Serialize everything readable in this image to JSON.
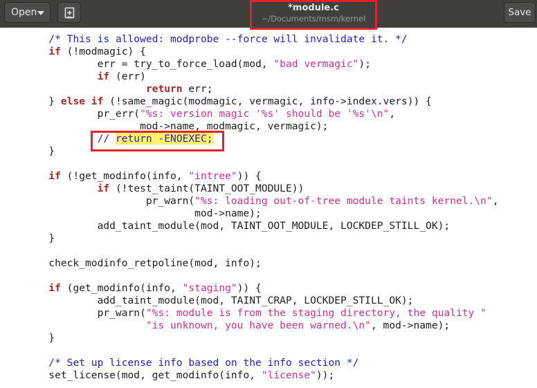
{
  "toolbar": {
    "open_label": "Open",
    "open_icon": "chevron-down-icon",
    "new_icon": "new-document-icon",
    "save_label": "Save"
  },
  "window": {
    "title": "*module.c",
    "path": "~/Documents/msm/kernel"
  },
  "code_lines": [
    [
      {
        "t": "        "
      },
      {
        "t": "/* This is allowed: modprobe --force will invalidate it. */",
        "c": "cmt"
      }
    ],
    [
      {
        "t": "        "
      },
      {
        "t": "if",
        "c": "kw"
      },
      {
        "t": " (!modmagic) {"
      }
    ],
    [
      {
        "t": "                err = try_to_force_load(mod, "
      },
      {
        "t": "\"bad vermagic\"",
        "c": "str"
      },
      {
        "t": ");"
      }
    ],
    [
      {
        "t": "                "
      },
      {
        "t": "if",
        "c": "kw"
      },
      {
        "t": " (err)"
      }
    ],
    [
      {
        "t": "                        "
      },
      {
        "t": "return",
        "c": "kw"
      },
      {
        "t": " err;"
      }
    ],
    [
      {
        "t": "        } "
      },
      {
        "t": "else if",
        "c": "kw"
      },
      {
        "t": " (!same_magic(modmagic, vermagic, info->index.vers)) {"
      }
    ],
    [
      {
        "t": "                pr_err("
      },
      {
        "t": "\"%s: version magic '%s' should be '%s'\\n\"",
        "c": "str"
      },
      {
        "t": ","
      }
    ],
    [
      {
        "t": "                       mod->name, modmagic, vermagic);"
      }
    ],
    [
      {
        "t": "                "
      },
      {
        "t": "// ",
        "c": "cmt"
      },
      {
        "t": "return -ENOEXEC;",
        "c": "cmt hl"
      }
    ],
    [
      {
        "t": "        }"
      }
    ],
    [],
    [
      {
        "t": "        "
      },
      {
        "t": "if",
        "c": "kw"
      },
      {
        "t": " (!get_modinfo(info, "
      },
      {
        "t": "\"intree\"",
        "c": "str"
      },
      {
        "t": ")) {"
      }
    ],
    [
      {
        "t": "                "
      },
      {
        "t": "if",
        "c": "kw"
      },
      {
        "t": " (!test_taint(TAINT_OOT_MODULE))"
      }
    ],
    [
      {
        "t": "                        pr_warn("
      },
      {
        "t": "\"%s: loading out-of-tree module taints kernel.\\n\"",
        "c": "str"
      },
      {
        "t": ","
      }
    ],
    [
      {
        "t": "                                mod->name);"
      }
    ],
    [
      {
        "t": "                add_taint_module(mod, TAINT_OOT_MODULE, LOCKDEP_STILL_OK);"
      }
    ],
    [
      {
        "t": "        }"
      }
    ],
    [],
    [
      {
        "t": "        check_modinfo_retpoline(mod, info);"
      }
    ],
    [],
    [
      {
        "t": "        "
      },
      {
        "t": "if",
        "c": "kw"
      },
      {
        "t": " (get_modinfo(info, "
      },
      {
        "t": "\"staging\"",
        "c": "str"
      },
      {
        "t": ")) {"
      }
    ],
    [
      {
        "t": "                add_taint_module(mod, TAINT_CRAP, LOCKDEP_STILL_OK);"
      }
    ],
    [
      {
        "t": "                pr_warn("
      },
      {
        "t": "\"%s: module is from the staging directory, the quality \"",
        "c": "str"
      }
    ],
    [
      {
        "t": "                        "
      },
      {
        "t": "\"is unknown, you have been warned.\\n\"",
        "c": "str"
      },
      {
        "t": ", mod->name);"
      }
    ],
    [
      {
        "t": "        }"
      }
    ],
    [],
    [
      {
        "t": "        "
      },
      {
        "t": "/* Set up license info based on the info section */",
        "c": "cmt"
      }
    ],
    [
      {
        "t": "        set_license(mod, get_modinfo(info, "
      },
      {
        "t": "\"license\"",
        "c": "str"
      },
      {
        "t": "));"
      }
    ]
  ],
  "colors": {
    "header_bg": "#403f3b",
    "keyword": "#a52a2a",
    "string": "#c8338e",
    "comment": "#2222ba",
    "highlight": "#fcf36a",
    "annotation_box": "#e2232b"
  }
}
